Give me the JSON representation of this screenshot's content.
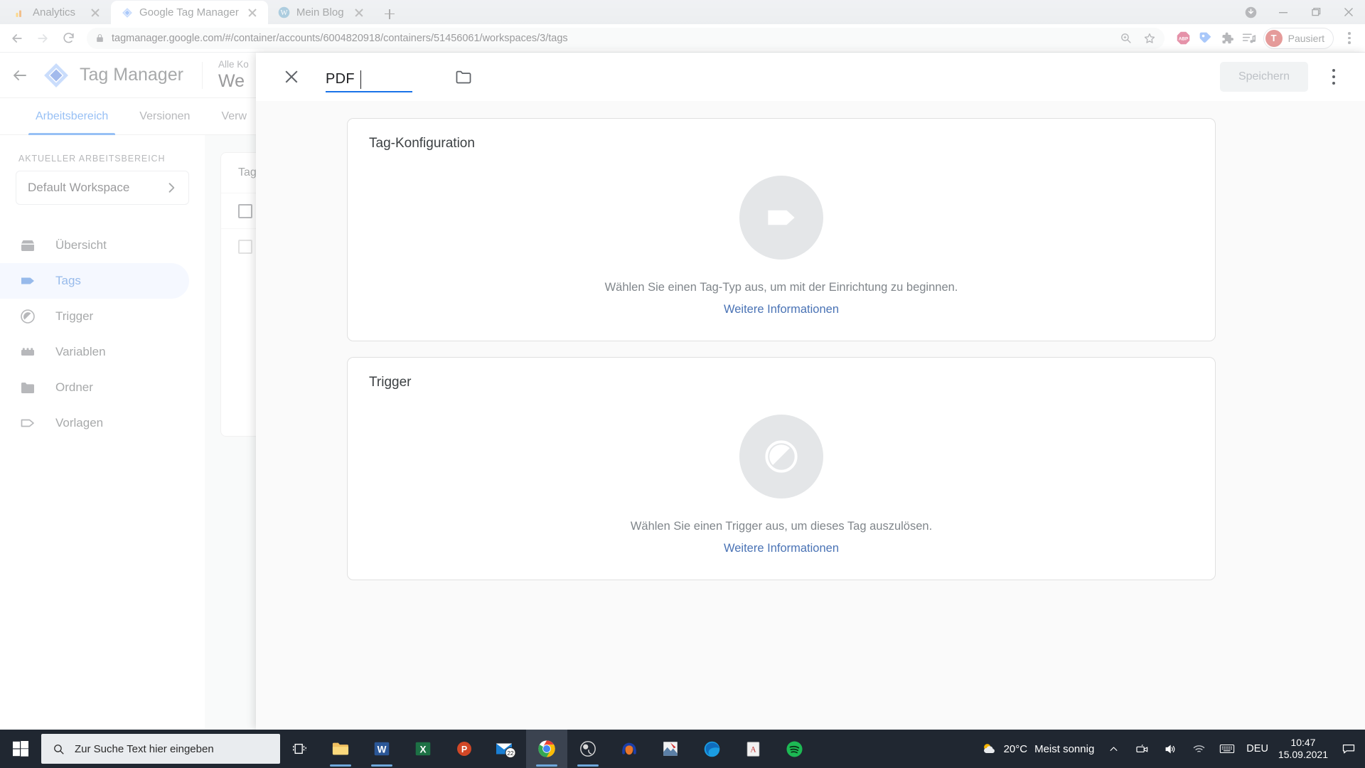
{
  "browser": {
    "tabs": [
      {
        "title": "Analytics",
        "favicon": "analytics-icon",
        "active": false
      },
      {
        "title": "Google Tag Manager",
        "favicon": "tag-manager-icon",
        "active": true
      },
      {
        "title": "Mein Blog",
        "favicon": "wordpress-icon",
        "active": false
      }
    ],
    "new_tab_label": "+",
    "url": "tagmanager.google.com/#/container/accounts/6004820918/containers/51456061/workspaces/3/tags",
    "profile": {
      "initial": "T",
      "label": "Pausiert"
    },
    "extensions": [
      "adblock-plus-icon",
      "tag-assistant-icon",
      "puzzle-extensions-icon",
      "reading-list-icon"
    ],
    "omnibox_actions": [
      "zoom-icon",
      "bookmark-star-icon"
    ]
  },
  "gtm": {
    "product_name": "Tag Manager",
    "account_label": "Alle Ko",
    "container_name": "We",
    "tabs": [
      {
        "label": "Arbeitsbereich",
        "active": true
      },
      {
        "label": "Versionen",
        "active": false
      },
      {
        "label": "Verw",
        "active": false
      }
    ],
    "sidebar": {
      "section_label": "AKTUELLER ARBEITSBEREICH",
      "workspace_name": "Default Workspace",
      "items": [
        {
          "label": "Übersicht",
          "icon": "overview-icon",
          "active": false
        },
        {
          "label": "Tags",
          "icon": "tag-icon",
          "active": true
        },
        {
          "label": "Trigger",
          "icon": "trigger-icon",
          "active": false
        },
        {
          "label": "Variablen",
          "icon": "variables-icon",
          "active": false
        },
        {
          "label": "Ordner",
          "icon": "folder-icon",
          "active": false
        },
        {
          "label": "Vorlagen",
          "icon": "templates-icon",
          "active": false
        }
      ]
    },
    "background_table": {
      "header": "Tag"
    }
  },
  "modal": {
    "close_label": "close-icon",
    "tag_name": "PDF",
    "folder_icon": "folder-icon",
    "save_label": "Speichern",
    "more_label": "more-options-icon",
    "cards": [
      {
        "title": "Tag-Konfiguration",
        "icon": "tag-shape-icon",
        "empty_text": "Wählen Sie einen Tag-Typ aus, um mit der Einrichtung zu beginnen.",
        "link_text": "Weitere Informationen"
      },
      {
        "title": "Trigger",
        "icon": "trigger-shape-icon",
        "empty_text": "Wählen Sie einen Trigger aus, um dieses Tag auszulösen.",
        "link_text": "Weitere Informationen"
      }
    ]
  },
  "taskbar": {
    "start_label": "start-icon",
    "search_placeholder": "Zur Suche Text hier eingeben",
    "task_view_label": "task-view-icon",
    "apps": [
      {
        "name": "file-explorer-icon",
        "badge": ""
      },
      {
        "name": "word-icon",
        "badge": ""
      },
      {
        "name": "excel-icon",
        "badge": ""
      },
      {
        "name": "powerpoint-icon",
        "badge": ""
      },
      {
        "name": "mail-icon",
        "badge": "22"
      },
      {
        "name": "chrome-icon",
        "badge": ""
      },
      {
        "name": "obs-icon",
        "badge": ""
      },
      {
        "name": "audacity-icon",
        "badge": ""
      },
      {
        "name": "snagit-icon",
        "badge": ""
      },
      {
        "name": "edge-icon",
        "badge": ""
      },
      {
        "name": "acrobat-icon",
        "badge": ""
      },
      {
        "name": "spotify-icon",
        "badge": ""
      }
    ],
    "weather_temp": "20°C",
    "weather_desc": "Meist sonnig",
    "language": "DEU",
    "time": "10:47",
    "date": "15.09.2021",
    "tray_icons": [
      "show-hidden-icons-chevron",
      "camera-icon",
      "volume-icon",
      "wifi-icon",
      "keyboard-icon"
    ],
    "notification_label": "notification-icon"
  },
  "colors": {
    "accent_blue": "#1a73e8",
    "link_blue": "#4a73b5",
    "nav_active_bg": "#e8f0fe",
    "taskbar_bg": "#202731",
    "profile_red": "#c5221f"
  }
}
